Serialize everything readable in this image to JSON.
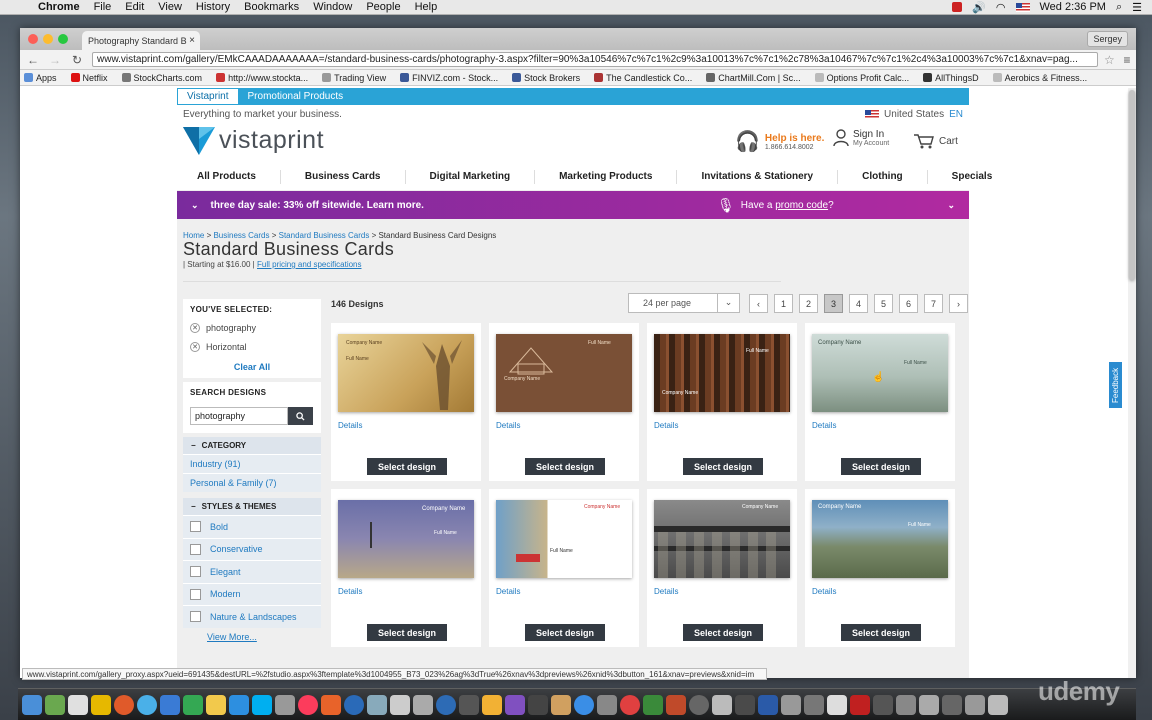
{
  "menubar": {
    "app": "Chrome",
    "items": [
      "File",
      "Edit",
      "View",
      "History",
      "Bookmarks",
      "Window",
      "People",
      "Help"
    ],
    "clock": "Wed 2:36 PM"
  },
  "browser": {
    "tab_title": "Photography Standard B",
    "user": "Sergey",
    "url": "www.vistaprint.com/gallery/EMkCAAADAAAAAAA=/standard-business-cards/photography-3.aspx?filter=90%3a10546%7c%7c1%2c9%3a10013%7c%7c1%2c78%3a10467%7c%7c1%2c4%3a10003%7c%7c1&xnav=pag...",
    "bookmarks": [
      "Apps",
      "Netflix",
      "StockCharts.com",
      "http://www.stockta...",
      "Trading View",
      "FINVIZ.com - Stock...",
      "Stock Brokers",
      "The Candlestick Co...",
      "ChartMill.Com | Sc...",
      "Options Profit Calc...",
      "AllThingsD",
      "Aerobics & Fitness..."
    ],
    "status_url": "www.vistaprint.com/gallery_proxy.aspx?ueid=691435&destURL=%2fstudio.aspx%3ftemplate%3d1004955_B73_023%26ag%3dTrue%26xnav%3dpreviews%26xnid%3dbutton_161&xnav=previews&xnid=im"
  },
  "site": {
    "tab_active": "Vistaprint",
    "tab_other": "Promotional Products",
    "tagline": "Everything to market your business.",
    "country": "United States",
    "lang": "EN",
    "logo": "vistaprint",
    "help_title": "Help is here.",
    "help_phone": "1.866.614.8002",
    "signin": "Sign In",
    "my_account": "My Account",
    "cart": "Cart",
    "nav": [
      "All Products",
      "Business Cards",
      "Digital Marketing",
      "Marketing Products",
      "Invitations & Stationery",
      "Clothing",
      "Specials"
    ],
    "promo_left": "three day sale: 33% off sitewide. Learn more.",
    "promo_right_pre": "Have a ",
    "promo_right_link": "promo code",
    "promo_right_post": "?"
  },
  "page": {
    "breadcrumb": [
      "Home",
      "Business Cards",
      "Standard Business Cards",
      "Standard Business Card Designs"
    ],
    "title": "Standard Business Cards",
    "price": "| Starting at $16.00 |",
    "price_link": "Full pricing and specifications",
    "count": "146 Designs",
    "per_page": "24 per page",
    "pages": [
      "1",
      "2",
      "3",
      "4",
      "5",
      "6",
      "7"
    ],
    "current_page": "3"
  },
  "sidebar": {
    "selected_title": "YOU'VE SELECTED:",
    "selected": [
      "photography",
      "Horizontal"
    ],
    "clear_all": "Clear All",
    "search_title": "SEARCH DESIGNS",
    "search_value": "photography",
    "category_title": "CATEGORY",
    "categories": [
      "Industry (91)",
      "Personal & Family (7)"
    ],
    "styles_title": "STYLES & THEMES",
    "styles": [
      "Bold",
      "Conservative",
      "Elegant",
      "Modern",
      "Nature & Landscapes"
    ],
    "view_more": "View More..."
  },
  "cards": {
    "details": "Details",
    "select": "Select design",
    "sample_company": "Company Name",
    "sample_name": "Full Name"
  },
  "feedback": "Feedback",
  "watermark": "udemy"
}
